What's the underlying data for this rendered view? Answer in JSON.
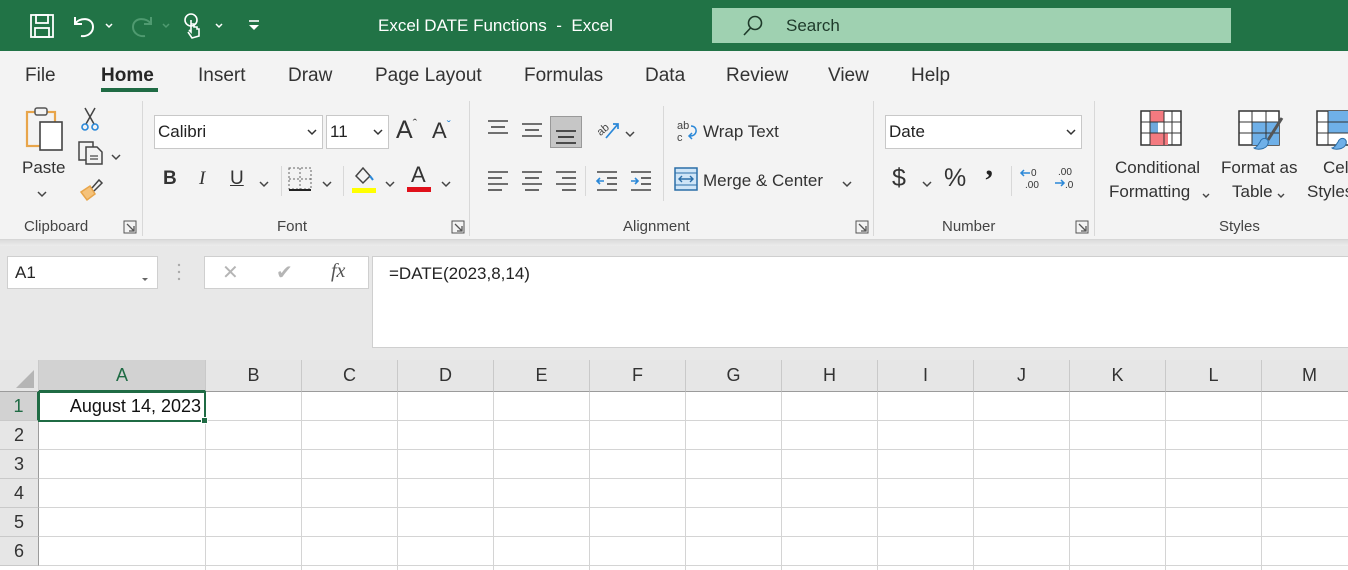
{
  "app": {
    "window_title": "Excel DATE Functions  -  Excel",
    "accent_color": "#217346",
    "search_placeholder": "Search"
  },
  "quick_access": {
    "icons": [
      "save-icon",
      "undo-icon",
      "redo-icon",
      "touch-mode-icon",
      "customize-qat-icon"
    ]
  },
  "tabs": [
    {
      "label": "File",
      "active": false
    },
    {
      "label": "Home",
      "active": true
    },
    {
      "label": "Insert",
      "active": false
    },
    {
      "label": "Draw",
      "active": false
    },
    {
      "label": "Page Layout",
      "active": false
    },
    {
      "label": "Formulas",
      "active": false
    },
    {
      "label": "Data",
      "active": false
    },
    {
      "label": "Review",
      "active": false
    },
    {
      "label": "View",
      "active": false
    },
    {
      "label": "Help",
      "active": false
    }
  ],
  "ribbon": {
    "clipboard": {
      "label": "Clipboard",
      "paste_label": "Paste"
    },
    "font": {
      "label": "Font",
      "font_name": "Calibri",
      "font_size": "11",
      "bold_label": "B",
      "italic_label": "I",
      "underline_label": "U",
      "font_color_letter": "A",
      "highlight_color": "#ffff00",
      "font_color": "#e0101a"
    },
    "alignment": {
      "label": "Alignment",
      "wrap_text_label": "Wrap Text",
      "merge_center_label": "Merge & Center"
    },
    "number": {
      "label": "Number",
      "format": "Date",
      "currency_symbol": "$",
      "percent_symbol": "%",
      "comma_symbol": "’"
    },
    "styles": {
      "label": "Styles",
      "conditional_formatting_line1": "Conditional",
      "conditional_formatting_line2": "Formatting",
      "format_as_table_line1": "Format as",
      "format_as_table_line2": "Table",
      "cell_styles_line1": "Cell",
      "cell_styles_line2": "Styles"
    }
  },
  "formula_bar": {
    "name_box": "A1",
    "cancel_symbol": "✕",
    "enter_symbol": "✔",
    "fx_label": "fx",
    "formula": "=DATE(2023,8,14)"
  },
  "sheet": {
    "columns": [
      "A",
      "B",
      "C",
      "D",
      "E",
      "F",
      "G",
      "H",
      "I",
      "J",
      "K",
      "L",
      "M"
    ],
    "rows": [
      "1",
      "2",
      "3",
      "4",
      "5",
      "6"
    ],
    "selected_cell": "A1",
    "cells": {
      "A1": "August 14, 2023"
    }
  }
}
